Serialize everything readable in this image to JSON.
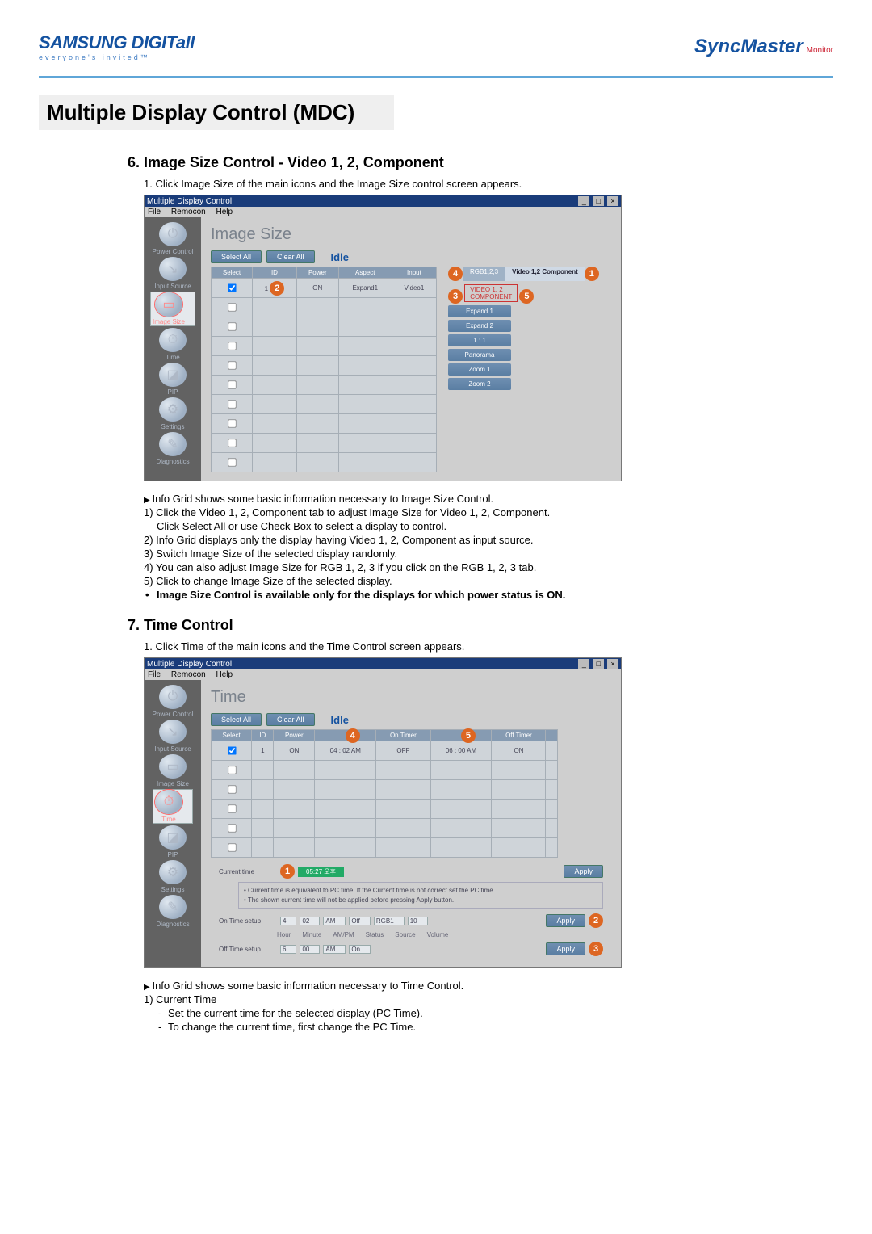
{
  "header": {
    "brand": "SAMSUNG DIGITall",
    "tagline": "everyone's invited™",
    "right_brand": "SyncMaster",
    "right_sub": "Monitor"
  },
  "page_title": "Multiple Display Control (MDC)",
  "section6": {
    "heading": "6. Image Size Control - Video 1, 2, Component",
    "intro": "Click Image Size of the main icons and the Image Size control screen appears.",
    "win_title": "Multiple Display Control",
    "menu": {
      "file": "File",
      "remocon": "Remocon",
      "help": "Help"
    },
    "sidebar": [
      "Power Control",
      "Input Source",
      "Image Size",
      "Time",
      "PIP",
      "Settings",
      "Diagnostics"
    ],
    "sidebar_selected": 2,
    "main_title": "Image Size",
    "select_all": "Select All",
    "clear_all": "Clear All",
    "idle": "Idle",
    "tabs": {
      "a": "RGB1,2,3",
      "b": "Video 1,2\nComponent"
    },
    "grid_headers": [
      "Select",
      "ID",
      "Power",
      "Aspect",
      "Input"
    ],
    "grid_row": {
      "id": "1",
      "power": "ON",
      "aspect": "Expand1",
      "input": "Video1"
    },
    "src_label": "VIDEO 1, 2\nCOMPONENT",
    "options": [
      "Expand 1",
      "Expand 2",
      "1 : 1",
      "Panorama",
      "Zoom 1",
      "Zoom 2"
    ],
    "badges": [
      "1",
      "2",
      "3",
      "4",
      "5"
    ],
    "notes": [
      {
        "t": "arrow",
        "v": "Info Grid shows some basic information necessary to Image Size Control."
      },
      {
        "t": "num",
        "i": "1",
        "v": "Click the Video 1, 2, Component tab to adjust Image Size for Video 1, 2, Component."
      },
      {
        "t": "plain",
        "v": "Click Select All or use Check Box to select a display to control."
      },
      {
        "t": "num",
        "i": "2",
        "v": "Info Grid displays only the display having Video 1, 2, Component as input source."
      },
      {
        "t": "num",
        "i": "3",
        "v": "Switch Image Size of the selected display randomly."
      },
      {
        "t": "num",
        "i": "4",
        "v": "You can also adjust Image Size for RGB 1, 2, 3 if you click on the RGB 1, 2, 3 tab."
      },
      {
        "t": "num",
        "i": "5",
        "v": "Click to change Image Size of the selected display."
      },
      {
        "t": "bullet",
        "v": "Image Size Control is available only for the displays for which power status is ON."
      }
    ]
  },
  "section7": {
    "heading": "7. Time Control",
    "intro": "Click Time of the main icons and the Time Control screen appears.",
    "win_title": "Multiple Display Control",
    "menu": {
      "file": "File",
      "remocon": "Remocon",
      "help": "Help"
    },
    "sidebar": [
      "Power Control",
      "Input Source",
      "Image Size",
      "Time",
      "PIP",
      "Settings",
      "Diagnostics"
    ],
    "sidebar_selected": 3,
    "main_title": "Time",
    "select_all": "Select All",
    "clear_all": "Clear All",
    "idle": "Idle",
    "grid_headers": [
      "Select",
      "ID",
      "Power",
      "",
      "On Timer",
      "",
      "Off Timer",
      ""
    ],
    "grid_row": {
      "id": "1",
      "power": "ON",
      "on": "04 : 02 AM",
      "status": "OFF",
      "off": "06 : 00 AM",
      "off_st": "ON"
    },
    "badges": [
      "1",
      "2",
      "3",
      "4",
      "5"
    ],
    "current_time_label": "Current time",
    "current_time_value": "05:27 오후",
    "apply": "Apply",
    "note1": "Current time is equivalent to PC time. If the Current time is not correct set the PC time.",
    "note2": "The shown current time will not be applied before pressing Apply button.",
    "on_time_label": "On Time setup",
    "off_time_label": "Off Time setup",
    "on_vals": {
      "h": "4",
      "m": "02",
      "ap": "AM",
      "st": "Off",
      "src": "RGB1",
      "vol": "10"
    },
    "off_vals": {
      "h": "6",
      "m": "00",
      "ap": "AM",
      "st": "On"
    },
    "col_labels": [
      "Hour",
      "Minute",
      "AM/PM",
      "Status",
      "Source",
      "Volume"
    ],
    "notes": [
      {
        "t": "arrow",
        "v": "Info Grid shows some basic information necessary to Time Control."
      },
      {
        "t": "num",
        "i": "1",
        "v": "Current Time"
      },
      {
        "t": "dash",
        "v": "Set the current time for the selected display (PC Time)."
      },
      {
        "t": "dash",
        "v": "To change the current time, first change the PC Time."
      }
    ]
  }
}
